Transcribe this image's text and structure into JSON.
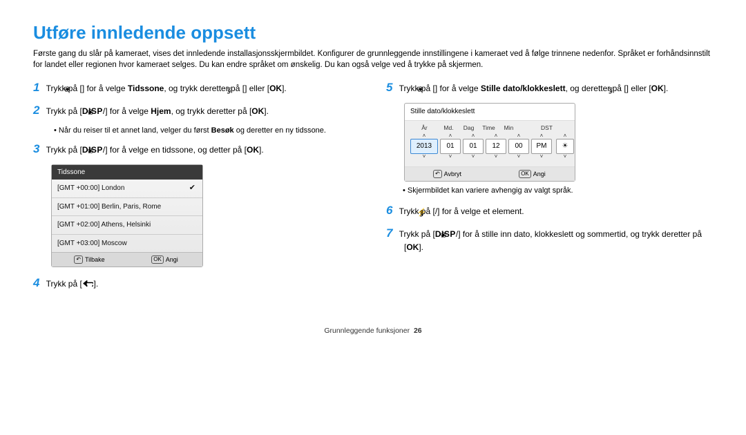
{
  "title": "Utføre innledende oppsett",
  "intro": "Første gang du slår på kameraet, vises det innledende installasjonsskjermbildet. Konfigurer de grunnleggende innstillingene i kameraet ved å følge trinnene nedenfor. Språket er forhåndsinnstilt for landet eller regionen hvor kameraet selges. Du kan endre språket om ønskelig. Du kan også velge ved å trykke på skjermen.",
  "icons": {
    "disp": "DISP",
    "ok": "OK",
    "back": "Tilbake",
    "angiBtn": "Angi",
    "avbryt": "Avbryt",
    "up": "˄",
    "down": "˅"
  },
  "steps_left": {
    "s1_pre": "Trykk på [",
    "s1_mid": "] for å velge ",
    "s1_bold": "Tidssone",
    "s1_post1": ", og trykk deretter på [",
    "s1_post2": "] eller [",
    "s1_post3": "].",
    "s2_pre": "Trykk på [",
    "s2_mid": "] for å velge ",
    "s2_bold": "Hjem",
    "s2_post1": ", og trykk deretter på [",
    "s2_post2": "].",
    "s2_bullet": "Når du reiser til et annet land, velger du først Besøk og deretter en ny tidssone.",
    "s2_bullet_bold": "Besøk",
    "s2_bullet_pre": "Når du reiser til et annet land, velger du først ",
    "s2_bullet_post": " og deretter en ny tidssone.",
    "s3_pre": "Trykk på [",
    "s3_mid": "] for å velge en tidssone, og detter på [",
    "s3_post": "].",
    "s4_pre": "Trykk på [",
    "s4_post": "]."
  },
  "tz_screen": {
    "title": "Tidssone",
    "rows": [
      "[GMT +00:00] London",
      "[GMT +01:00] Berlin, Paris, Rome",
      "[GMT +02:00] Athens, Helsinki",
      "[GMT +03:00] Moscow"
    ],
    "selected_index": 0,
    "back": "Tilbake",
    "angi": "Angi"
  },
  "steps_right": {
    "s5_pre": "Trykk på [",
    "s5_mid": "] for å velge ",
    "s5_bold": "Stille dato/klokkeslett",
    "s5_post1": ", og deretter på [",
    "s5_post2": "] eller [",
    "s5_post3": "].",
    "dt_note": "Skjermbildet kan variere avhengig av valgt språk.",
    "s6_pre": "Trykk på [",
    "s6_post": "] for å velge et element.",
    "s7_pre": "Trykk på [",
    "s7_mid": "] for å stille inn dato, klokkeslett og sommertid, og trykk deretter på [",
    "s7_post": "]."
  },
  "dt_screen": {
    "title": "Stille dato/klokkeslett",
    "labels": [
      "År",
      "Md.",
      "Dag",
      "Time",
      "Min",
      "",
      "DST"
    ],
    "values": {
      "year": "2013",
      "month": "01",
      "day": "01",
      "hour": "12",
      "min": "00",
      "ampm": "PM"
    },
    "avbryt": "Avbryt",
    "angi": "Angi"
  },
  "footer": {
    "section": "Grunnleggende funksjoner",
    "page": "26"
  },
  "chart_data": null
}
